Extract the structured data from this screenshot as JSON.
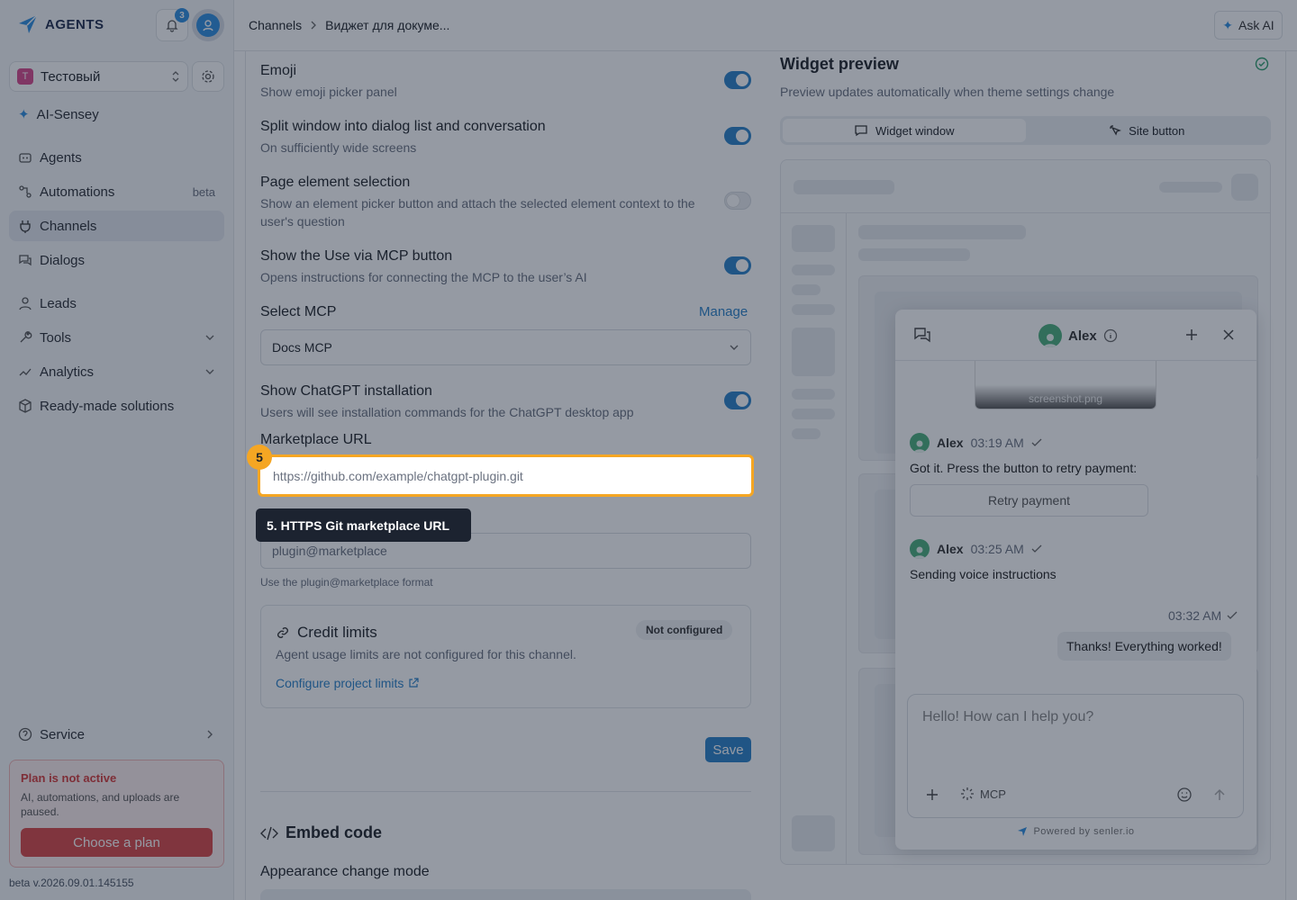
{
  "app": {
    "logo_text": "AGENTS",
    "notifications_count": "3"
  },
  "workspace": {
    "badge": "Т",
    "name": "Тестовый"
  },
  "sidebar": {
    "items": [
      {
        "label": "AI-Sensey",
        "icon": "sparkle-icon"
      },
      {
        "label": "Agents",
        "icon": "agents-icon"
      },
      {
        "label": "Automations",
        "icon": "automation-icon",
        "tag": "beta"
      },
      {
        "label": "Channels",
        "icon": "plug-icon",
        "active": true
      },
      {
        "label": "Dialogs",
        "icon": "dialogs-icon"
      },
      {
        "label": "Leads",
        "icon": "user-icon"
      },
      {
        "label": "Tools",
        "icon": "wrench-icon"
      },
      {
        "label": "Analytics",
        "icon": "chart-icon"
      },
      {
        "label": "Ready-made solutions",
        "icon": "box-icon"
      }
    ],
    "service": "Service",
    "plan": {
      "title": "Plan is not active",
      "text": "AI, automations, and uploads are paused.",
      "button": "Choose a plan"
    },
    "version": "beta v.2026.09.01.145155"
  },
  "header": {
    "breadcrumb": [
      "Channels",
      "Виджет для докуме..."
    ],
    "ask_ai": "Ask AI"
  },
  "settings": {
    "emoji": {
      "title": "Emoji",
      "desc": "Show emoji picker panel",
      "enabled": true
    },
    "split": {
      "title": "Split window into dialog list and conversation",
      "desc": "On sufficiently wide screens",
      "enabled": true
    },
    "element_selection": {
      "title": "Page element selection",
      "desc": "Show an element picker button and attach the selected element context to the user's question",
      "enabled": false
    },
    "mcp_button": {
      "title": "Show the Use via MCP button",
      "desc": "Opens instructions for connecting the MCP to the user’s AI",
      "enabled": true
    },
    "select_mcp": {
      "title": "Select MCP",
      "manage": "Manage",
      "value": "Docs MCP"
    },
    "chatgpt": {
      "title": "Show ChatGPT installation",
      "desc": "Users will see installation commands for the ChatGPT desktop app",
      "enabled": true
    },
    "marketplace_url": {
      "label": "Marketplace URL",
      "placeholder": "https://github.com/example/chatgpt-plugin.git"
    },
    "plugin": {
      "placeholder": "plugin@marketplace",
      "hint": "Use the plugin@marketplace format"
    },
    "credit": {
      "title": "Credit limits",
      "status": "Not configured",
      "desc": "Agent usage limits are not configured for this channel.",
      "link": "Configure project limits"
    },
    "save": "Save",
    "embed_title": "Embed code",
    "appearance_title": "Appearance change mode"
  },
  "highlight": {
    "step": "5",
    "tooltip": "5. HTTPS Git marketplace URL"
  },
  "preview": {
    "title": "Widget preview",
    "desc": "Preview updates automatically when theme settings change",
    "tabs": [
      {
        "label": "Widget window",
        "active": true
      },
      {
        "label": "Site button",
        "active": false
      }
    ],
    "chat": {
      "agent_name": "Alex",
      "attachment": "screenshot.png",
      "messages": [
        {
          "name": "Alex",
          "time": "03:19 AM",
          "text": "Got it. Press the button to retry payment:",
          "button": "Retry payment"
        },
        {
          "name": "Alex",
          "time": "03:25 AM",
          "text": "Sending voice instructions"
        }
      ],
      "user_msg": {
        "time": "03:32 AM",
        "text": "Thanks! Everything worked!"
      },
      "input_placeholder": "Hello! How can I help you?",
      "mcp_label": "MCP",
      "powered": "Powered by senler.io"
    }
  },
  "colors": {
    "accent": "#2b82c9",
    "highlight": "#f5a623",
    "danger": "#d94848"
  }
}
